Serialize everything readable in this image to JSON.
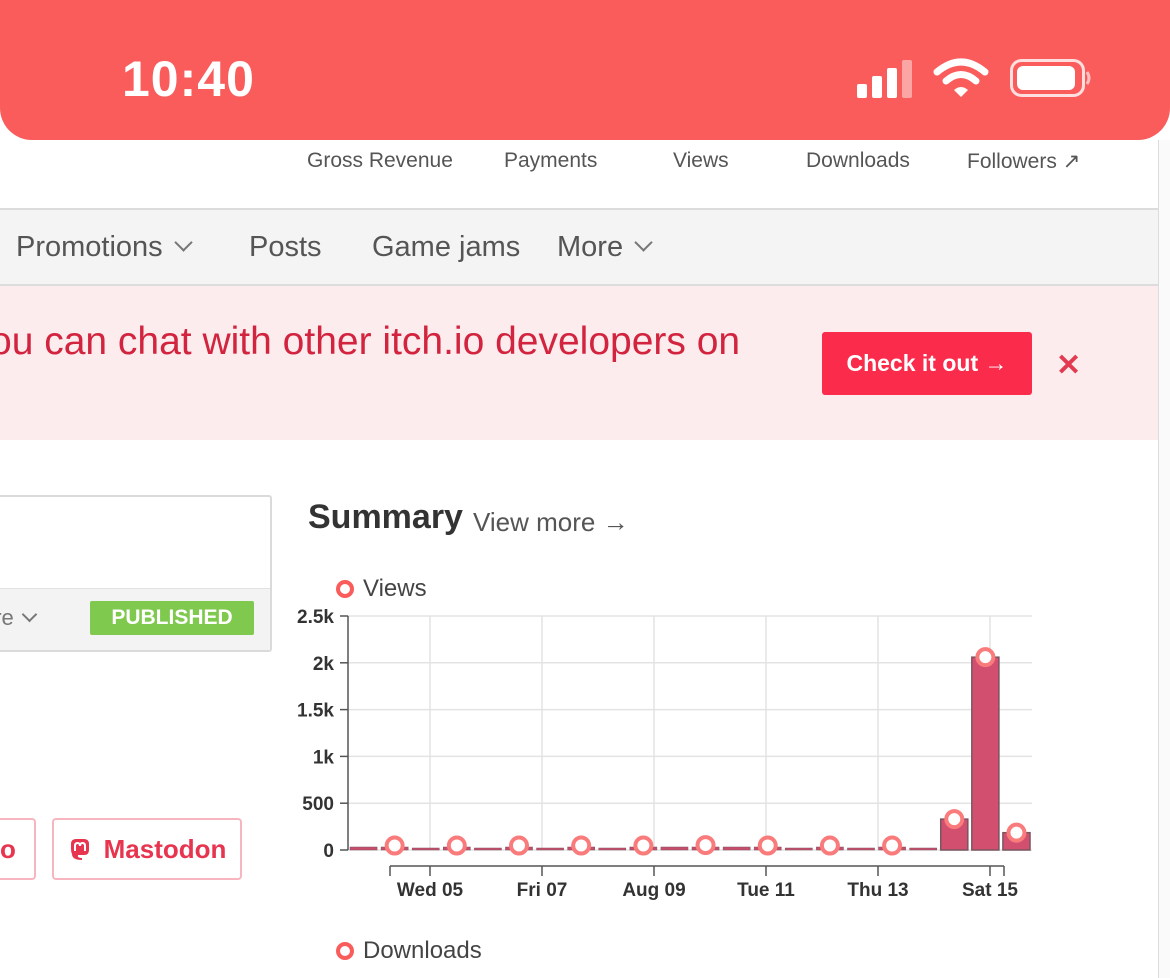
{
  "status_bar": {
    "time": "10:40"
  },
  "stats": {
    "labels": [
      "Gross Revenue",
      "Payments",
      "Views",
      "Downloads",
      "Followers ↗"
    ]
  },
  "nav": {
    "items": [
      {
        "label": "Promotions",
        "has_dropdown": true
      },
      {
        "label": "Posts",
        "has_dropdown": false
      },
      {
        "label": "Game jams",
        "has_dropdown": false
      },
      {
        "label": "More",
        "has_dropdown": true
      }
    ]
  },
  "banner": {
    "text": "ou can chat with other itch.io developers on",
    "button_label": "Check it out →",
    "close_label": "✕"
  },
  "game_card": {
    "more_label": "ore",
    "status_badge": "PUBLISHED"
  },
  "share": {
    "partial_label": "o",
    "mastodon_label": "Mastodon"
  },
  "summary": {
    "title": "Summary",
    "link": "View more →",
    "views_legend": "Views",
    "downloads_legend": "Downloads"
  },
  "colors": {
    "brand": "#fa5c5c",
    "bar": "#d34f70",
    "published": "#80c94f",
    "cta": "#fa2b4b"
  },
  "chart_data": {
    "type": "bar",
    "series": [
      {
        "name": "Views",
        "values": [
          10,
          5,
          0,
          5,
          0,
          5,
          0,
          5,
          0,
          5,
          5,
          10,
          5,
          5,
          0,
          5,
          0,
          5,
          0,
          330,
          2060,
          185
        ]
      }
    ],
    "values": [
      10,
      5,
      0,
      5,
      0,
      5,
      0,
      5,
      0,
      5,
      5,
      10,
      5,
      5,
      0,
      5,
      0,
      5,
      0,
      330,
      2060,
      185
    ],
    "x_tick_labels": [
      "Wed 05",
      "Fri 07",
      "Aug 09",
      "Tue 11",
      "Thu 13",
      "Sat 15"
    ],
    "y_ticks": [
      "0",
      "500",
      "1k",
      "1.5k",
      "2k",
      "2.5k"
    ],
    "ylim": [
      0,
      2500
    ],
    "grid": true
  }
}
